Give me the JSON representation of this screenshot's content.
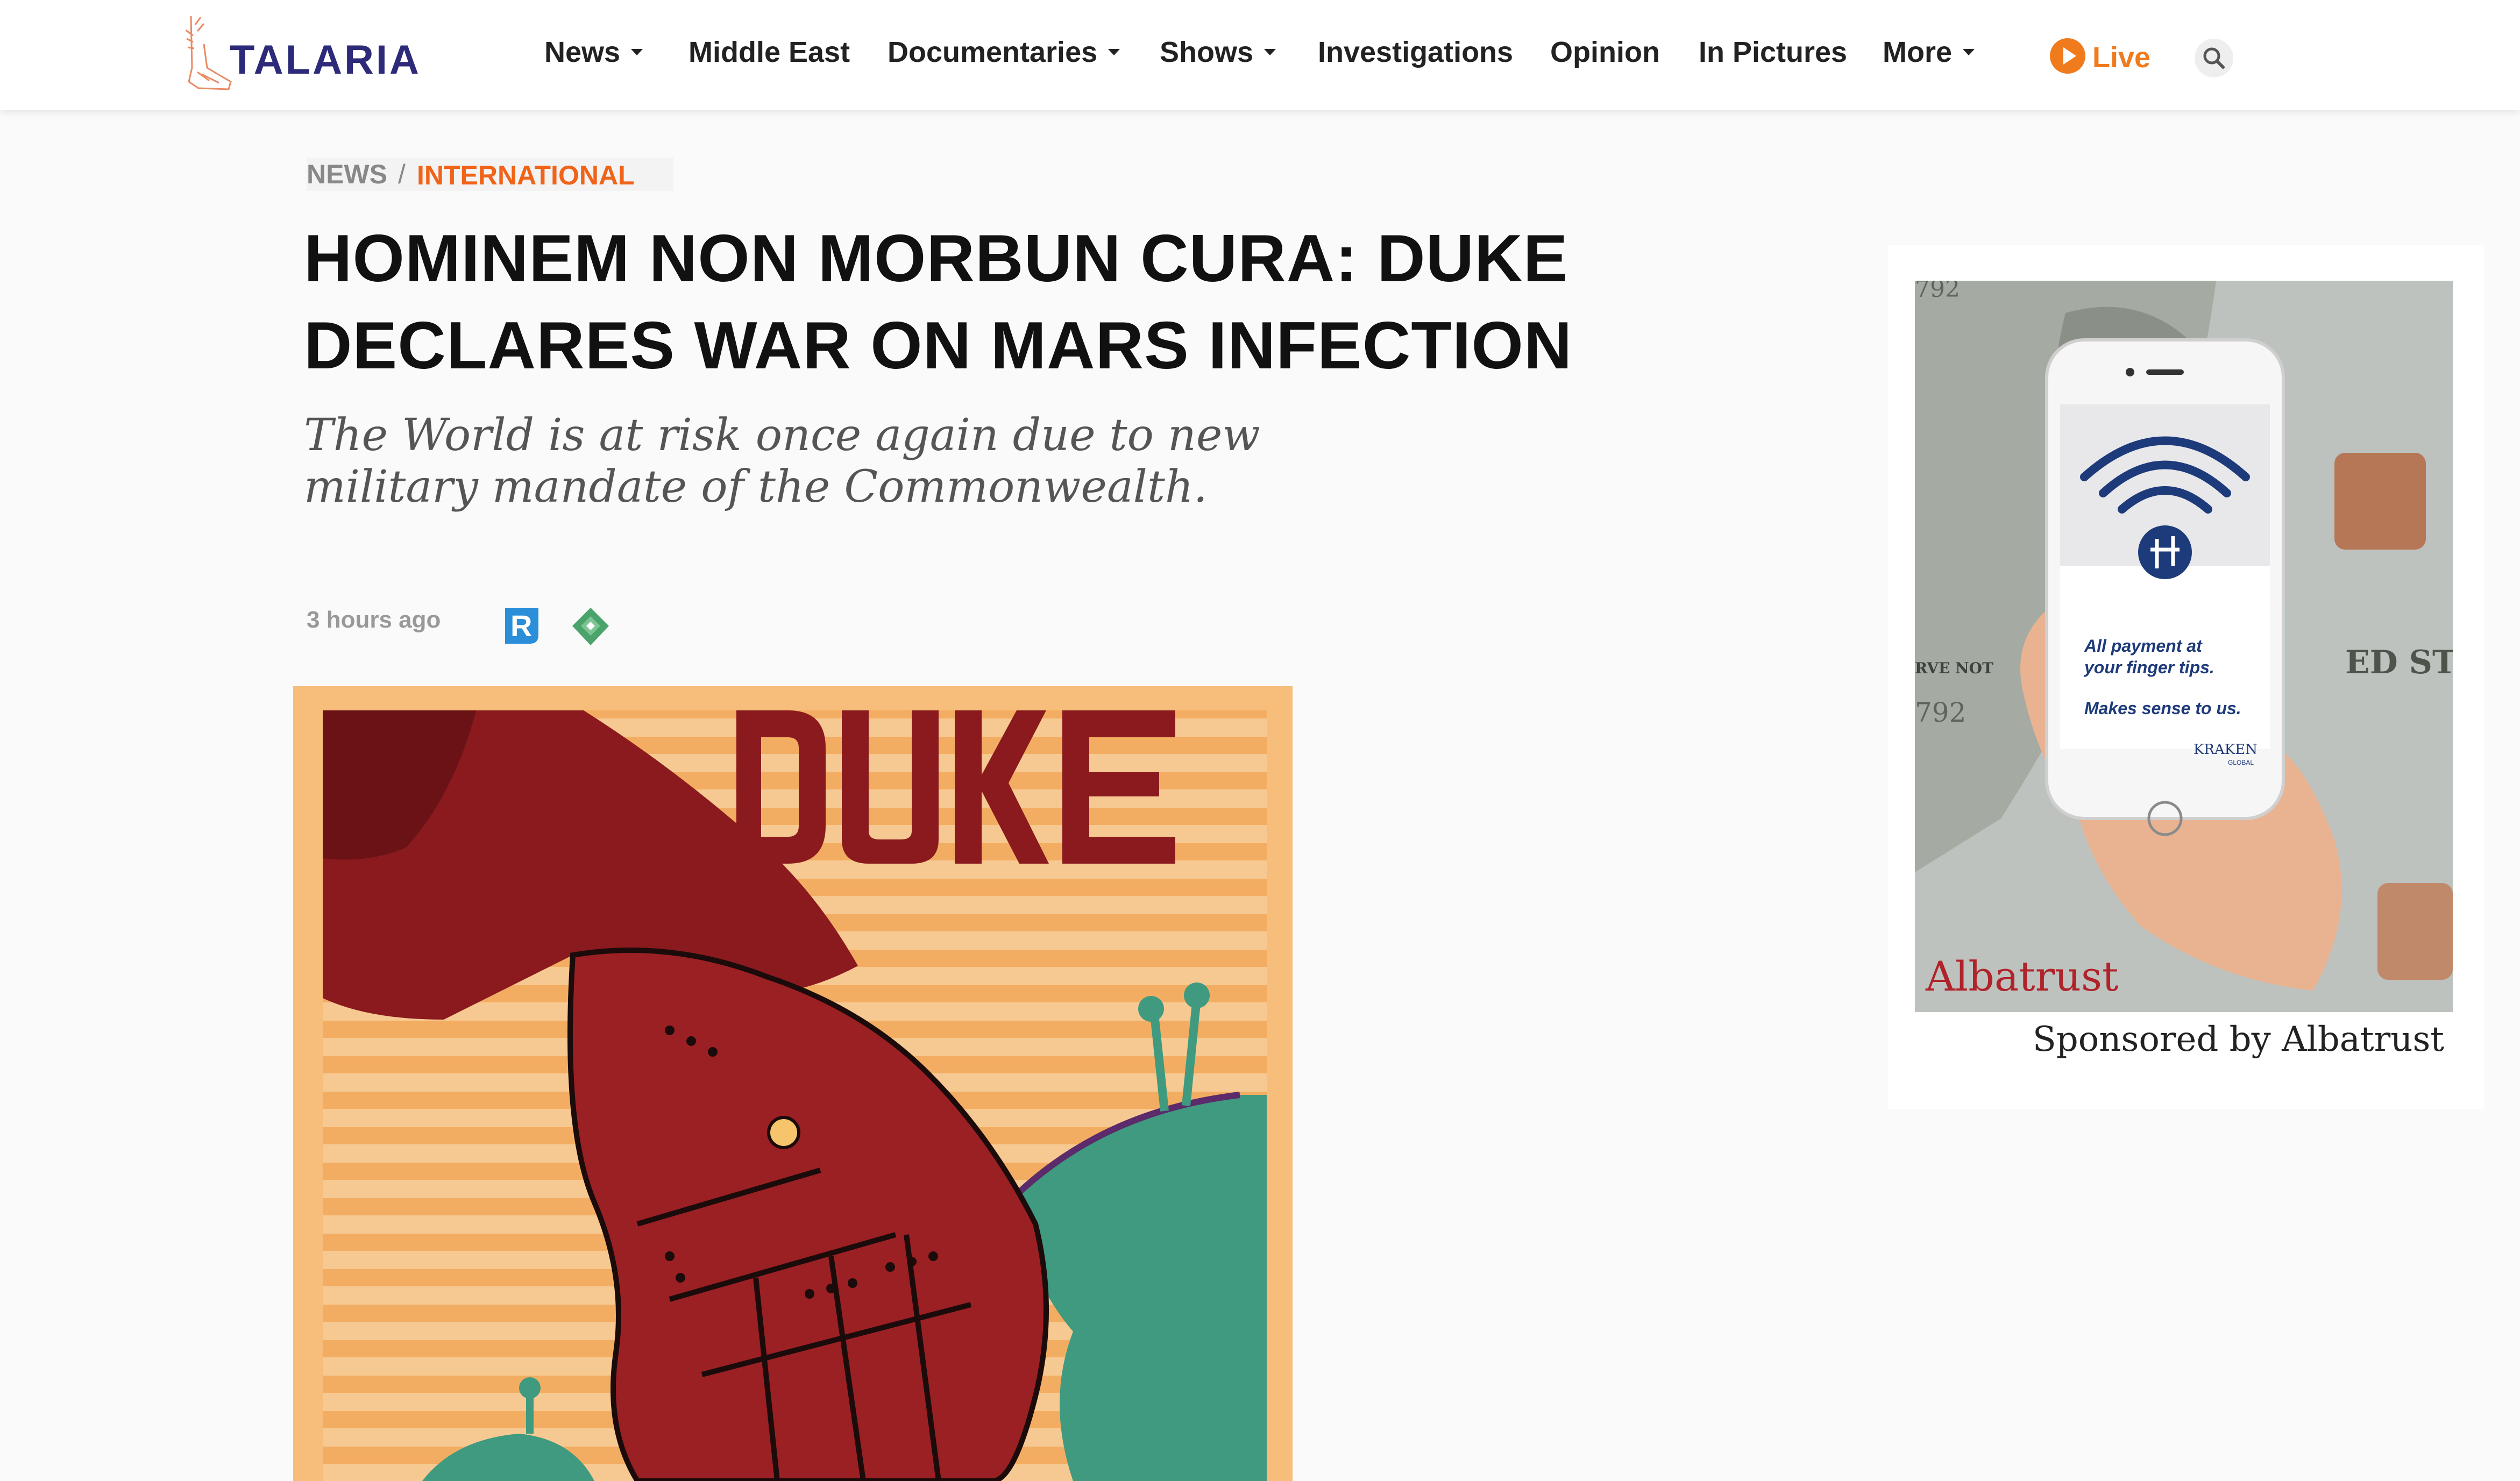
{
  "header": {
    "brand": "TALARIA",
    "nav": [
      {
        "label": "News",
        "dropdown": true
      },
      {
        "label": "Middle East",
        "dropdown": false
      },
      {
        "label": "Documentaries",
        "dropdown": true
      },
      {
        "label": "Shows",
        "dropdown": true
      },
      {
        "label": "Investigations",
        "dropdown": false
      },
      {
        "label": "Opinion",
        "dropdown": false
      },
      {
        "label": "In Pictures",
        "dropdown": false
      },
      {
        "label": "More",
        "dropdown": true
      }
    ],
    "live_label": "Live",
    "search_icon": "search-icon"
  },
  "breadcrumb": {
    "section": "NEWS",
    "separator": "/",
    "subsection": "INTERNATIONAL"
  },
  "article": {
    "headline": "HOMINEM NON MORBUN CURA: DUKE DECLARES WAR ON MARS INFECTION",
    "subheadline": "The World is at risk once again due to new military mandate of the Commonwealth.",
    "timestamp": "3 hours ago",
    "share_icons": [
      "r-share-icon",
      "feedly-share-icon"
    ],
    "hero_poster_text": "DUKE"
  },
  "ad": {
    "ad_brand": "Albatrust",
    "phone_line1": "All payment at",
    "phone_line2": "your finger tips.",
    "phone_line3": "Makes sense to us.",
    "phone_brand": "KRAKEN",
    "phone_brand_sub": "GLOBAL",
    "caption": "Sponsored by Albatrust"
  },
  "colors": {
    "brand": "#2d2a7a",
    "accent_orange": "#f06318",
    "live_orange": "#f07b1d",
    "poster_red": "#8a1a1e",
    "poster_background": "#f7bd7a",
    "poster_green": "#3f9a7f"
  }
}
